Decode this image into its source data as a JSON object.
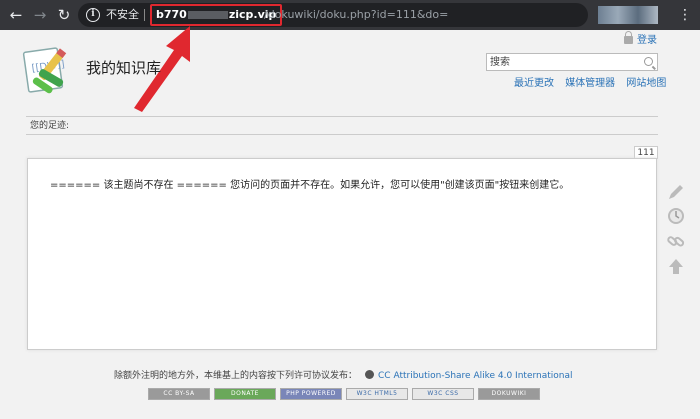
{
  "browser": {
    "security_label": "不安全",
    "url_host_prefix": "b770",
    "url_host_suffix": "zicp.vip",
    "url_path": "/dokuwiki/doku.php?id=111&do="
  },
  "header": {
    "site_title": "我的知识库",
    "login_label": "登录",
    "search_placeholder": "搜索",
    "tools": [
      "最近更改",
      "媒体管理器",
      "网站地图"
    ]
  },
  "breadcrumbs": {
    "label": "您的足迹:"
  },
  "page": {
    "id_tab": "111",
    "message": "====== 该主题尚不存在 ====== 您访问的页面并不存在。如果允许，您可以使用\"创建该页面\"按钮来创建它。"
  },
  "footer": {
    "license_text": "除额外注明的地方外，本维基上的内容按下列许可协议发布：",
    "license_link": "CC Attribution-Share Alike 4.0 International",
    "badges": [
      "CC BY-SA",
      "DONATE",
      "PHP POWERED",
      "W3C HTML5",
      "W3C CSS",
      "DOKUWIKI"
    ]
  },
  "colors": {
    "link": "#2b73b7",
    "annotation_red": "#e0282f",
    "chrome_bg": "#35363a"
  }
}
